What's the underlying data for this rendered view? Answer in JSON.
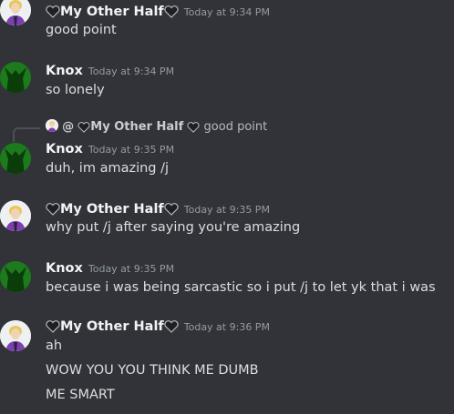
{
  "messages": [
    {
      "author": "My Other Half",
      "timestamp": "Today at 9:34 PM",
      "avatar": "blonde-person-avatar",
      "lines": [
        "good point"
      ]
    },
    {
      "author": "Knox",
      "timestamp": "Today at 9:34 PM",
      "avatar": "green-alien-avatar",
      "lines": [
        "so lonely"
      ]
    },
    {
      "author": "Knox",
      "timestamp": "Today at 9:35 PM",
      "avatar": "green-alien-avatar",
      "reply": {
        "at": "@",
        "author": "My Other Half",
        "text": "good point"
      },
      "lines": [
        "duh, im amazing /j"
      ]
    },
    {
      "author": "My Other Half",
      "timestamp": "Today at 9:35 PM",
      "avatar": "blonde-person-avatar",
      "lines": [
        "why put /j after saying you're amazing"
      ]
    },
    {
      "author": "Knox",
      "timestamp": "Today at 9:35 PM",
      "avatar": "green-alien-avatar",
      "lines": [
        "because i was being sarcastic so i put /j to let yk that i was"
      ]
    },
    {
      "author": "My Other Half",
      "timestamp": "Today at 9:36 PM",
      "avatar": "blonde-person-avatar",
      "lines": [
        "ah",
        "WOW YOU YOU THINK ME DUMB",
        "ME SMART"
      ]
    }
  ],
  "colors": {
    "background": "#313338",
    "author_name": "#f2f3f5",
    "timestamp": "#949ba4",
    "message_text": "#dbdee1"
  }
}
